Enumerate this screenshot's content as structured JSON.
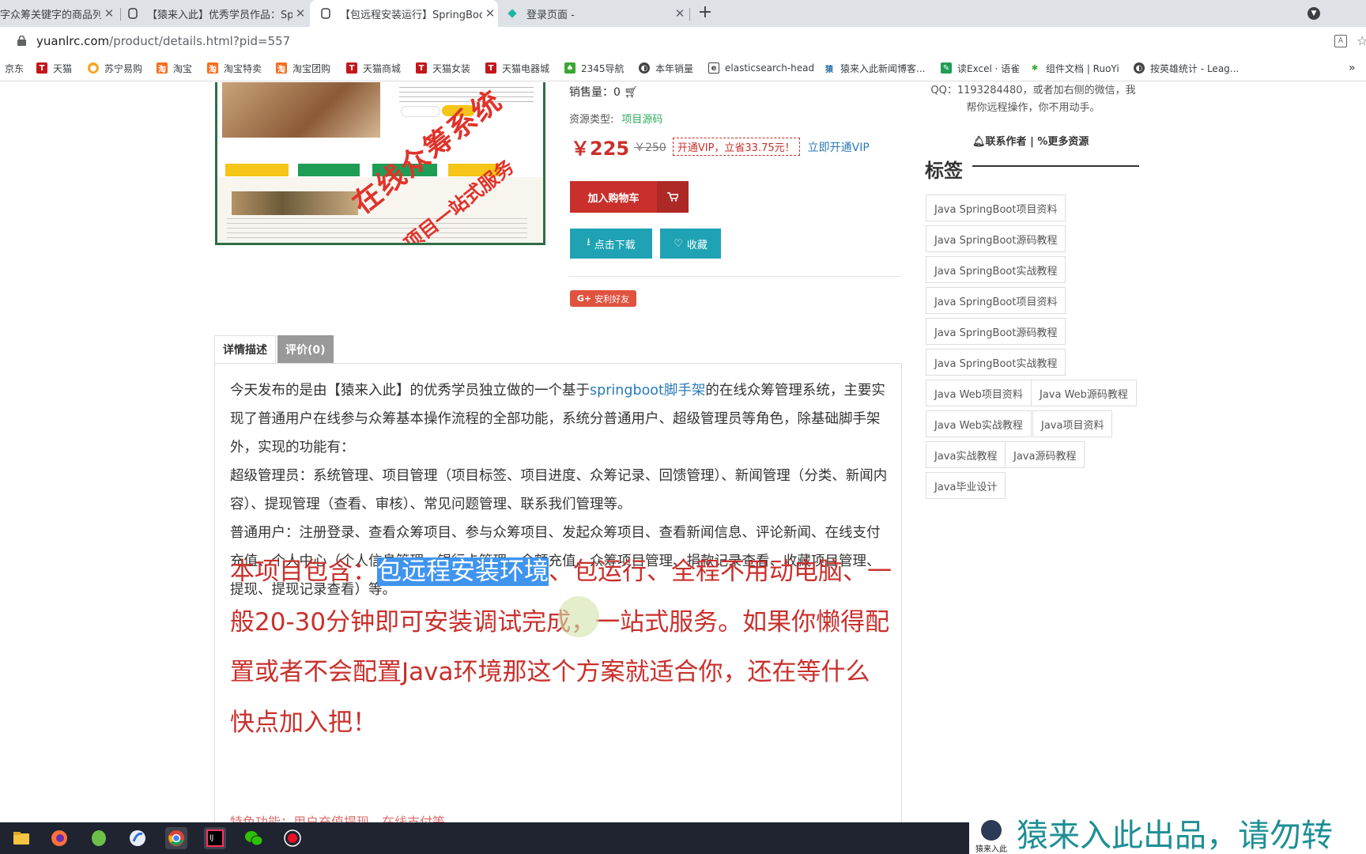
{
  "browser": {
    "tabs": [
      {
        "title": "字众筹关键字的商品列表",
        "active": false
      },
      {
        "title": "【猿来入此】优秀学员作品：Spr",
        "active": false
      },
      {
        "title": "【包远程安装运行】SpringBoot",
        "active": true
      },
      {
        "title": "登录页面 -",
        "active": false
      }
    ],
    "close_glyph": "✕",
    "new_tab_glyph": "+",
    "url_domain": "yuanlrc.com",
    "url_path": "/product/details.html?pid=557",
    "bookmarks": [
      {
        "label": "京东",
        "icon": "none"
      },
      {
        "label": "天猫",
        "icon": "tmall-icon"
      },
      {
        "label": "苏宁易购",
        "icon": "suning-icon"
      },
      {
        "label": "淘宝",
        "icon": "taobao-icon"
      },
      {
        "label": "淘宝特卖",
        "icon": "taobao-icon"
      },
      {
        "label": "淘宝团购",
        "icon": "taobao-icon"
      },
      {
        "label": "天猫商城",
        "icon": "tmall-icon"
      },
      {
        "label": "天猫女装",
        "icon": "tmall-icon"
      },
      {
        "label": "天猫电器城",
        "icon": "tmall-icon"
      },
      {
        "label": "2345导航",
        "icon": "nav-icon"
      },
      {
        "label": "本年销量",
        "icon": "globe-icon"
      },
      {
        "label": "elasticsearch-head",
        "icon": "es-icon"
      },
      {
        "label": "猿来入此新闻博客...",
        "icon": "ylrc-icon"
      },
      {
        "label": "读Excel · 语雀",
        "icon": "yuque-icon"
      },
      {
        "label": "组件文档 | RuoYi",
        "icon": "ruoyi-icon"
      },
      {
        "label": "按英雄统计 - Leag...",
        "icon": "globe-icon"
      }
    ],
    "bookmark_more": "»"
  },
  "product": {
    "watermark_main": "在线众筹系统",
    "watermark_sub": "项目一站式服务",
    "sold_label": "销售量：0",
    "resource_type_label": "资源类型:",
    "resource_type_value": "项目源码",
    "price": "￥225",
    "old_price": "￥250",
    "vip_offer": "开通VIP，立省33.75元！",
    "vip_link": "立即开通VIP",
    "add_cart": "加入购物车",
    "download": "点击下载",
    "favorite": "收藏",
    "share": "安利好友"
  },
  "detail": {
    "tab_desc": "详情描述",
    "tab_review": "评价(0)",
    "para1_a": "今天发布的是由【猿来入此】的优秀学员独立做的一个基于",
    "para1_link": "springboot脚手架",
    "para1_b": "的在线众筹管理系统，主要实现了普通用户在线参与众筹基本操作流程的全部功能，系统分普通用户、超级管理员等角色，除基础脚手架外，实现的功能有：",
    "para2": "超级管理员：系统管理、项目管理（项目标签、项目进度、众筹记录、回馈管理）、新闻管理（分类、新闻内容）、提现管理（查看、审核）、常见问题管理、联系我们管理等。",
    "para3": "普通用户：注册登录、查看众筹项目、参与众筹项目、发起众筹项目、查看新闻信息、评论新闻、在线支付充值、个人中心（个人信息管理、银行卡管理、余额充值、众筹项目管理、捐款记录查看、收藏项目管理、提现、提现记录查看）等。",
    "big_prefix": "本项目包含：",
    "big_highlight": "包远程安装环境",
    "big_rest": "、包运行、全程不用动电脑、一般20-30分钟即可安装调试完成，一站式服务。如果你懒得配置或者不会配置Java环境那这个方案就适合你，还在等什么快点加入把！",
    "faded_line": "特色功能：用户充值提现、在线支付等"
  },
  "sidebar": {
    "qq_text": "QQ：1193284480，或者加右侧的微信，我帮你远程操作，你不用动手。",
    "contact_author": "联系作者",
    "divider": "|",
    "more_resources": "更多资源",
    "tags_title": "标签",
    "tags": [
      "Java SpringBoot项目资料",
      "Java SpringBoot源码教程",
      "Java SpringBoot实战教程",
      "Java SpringBoot项目资料",
      "Java SpringBoot源码教程",
      "Java SpringBoot实战教程",
      "Java Web项目资料",
      "Java Web源码教程",
      "Java Web实战教程",
      "Java项目资料",
      "Java实战教程",
      "Java源码教程",
      "Java毕业设计"
    ]
  },
  "overlay": {
    "brand_logo_text": "猿来入此",
    "brand_text": "猿来入此出品，请勿转"
  },
  "colors": {
    "accent_red": "#c9302c",
    "teal_button": "#1fa3b4",
    "link_blue": "#2a7ab8",
    "green": "#2eab5c"
  }
}
